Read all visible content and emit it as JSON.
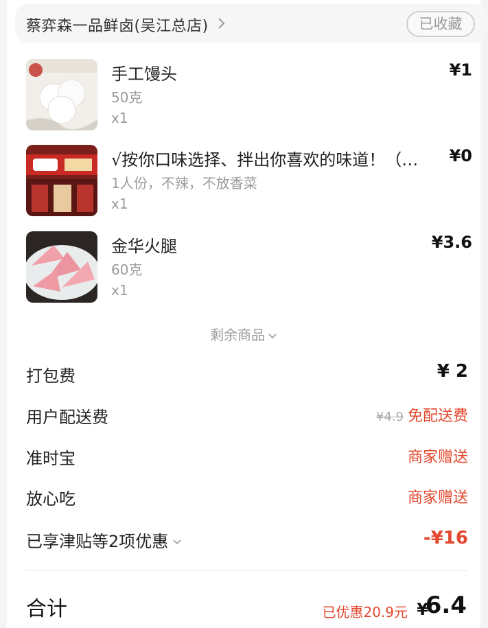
{
  "store": {
    "name": "蔡弈森一品鲜卤(吴江总店)",
    "favorite_label": "已收藏"
  },
  "items": [
    {
      "name": "手工馒头",
      "spec": "50克",
      "qty": "x1",
      "price": "¥1",
      "image": "steamed-buns-image"
    },
    {
      "name": "√按你口味选择、拌出你喜欢的味道！（…",
      "spec": "1人份，不辣，不放香菜",
      "qty": "x1",
      "price": "¥0",
      "image": "storefront-image"
    },
    {
      "name": "金华火腿",
      "spec": "60克",
      "qty": "x1",
      "price": "¥3.6",
      "image": "ham-slices-image"
    }
  ],
  "more_items_label": "剩余商品",
  "fees": {
    "packing": {
      "label": "打包费",
      "value": "¥ 2"
    },
    "delivery": {
      "label": "用户配送费",
      "original": "¥4.9",
      "value": "免配送费"
    },
    "ontime": {
      "label": "准时宝",
      "value": "商家赠送"
    },
    "assurance": {
      "label": "放心吃",
      "value": "商家赠送"
    },
    "discounts": {
      "label": "已享津贴等2项优惠",
      "value": "-¥16"
    }
  },
  "total": {
    "label": "合计",
    "saved": "已优惠20.9元",
    "currency": "¥",
    "amount": "6.4"
  },
  "colors": {
    "accent_red": "#e3472d",
    "muted_gray": "#9b9b9b"
  }
}
